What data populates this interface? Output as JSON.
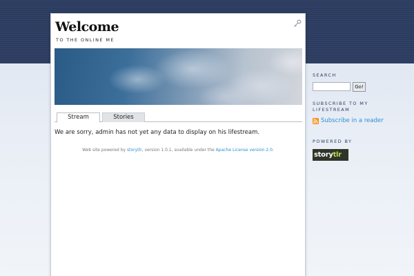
{
  "header": {
    "title": "Welcome",
    "tagline": "TO THE ONLINE ME"
  },
  "tabs": [
    {
      "label": "Stream",
      "active": true
    },
    {
      "label": "Stories",
      "active": false
    }
  ],
  "content": {
    "message": "We are sorry, admin has not yet any data to display on his lifestream."
  },
  "footer": {
    "prefix": "Web site powered by ",
    "storytlr_link": "storytlr",
    "middle": ", version 1.0.1, available under the ",
    "license_link": "Apache License version 2.0",
    "suffix": "."
  },
  "sidebar": {
    "search_heading": "SEARCH",
    "search_value": "",
    "search_button": "Go!",
    "subscribe_heading": "SUBSCRIBE TO MY LIFESTREAM",
    "subscribe_link": "Subscribe in a reader",
    "powered_heading": "POWERED BY",
    "logo_part1": "story",
    "logo_part2": "tlr"
  },
  "icons": {
    "login": "key-icon",
    "feed": "rss-icon"
  },
  "colors": {
    "header_band": "#2b3c60",
    "link": "#2a8fd6",
    "rss": "#f7931e"
  }
}
